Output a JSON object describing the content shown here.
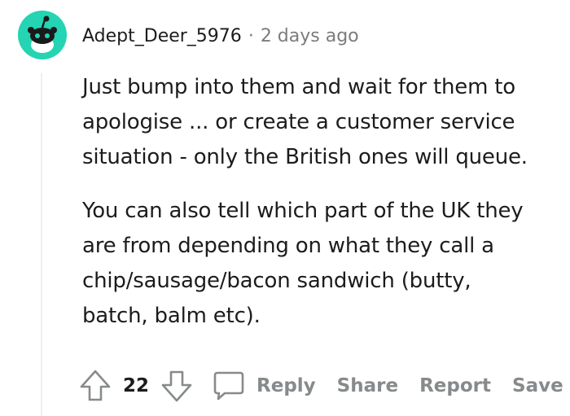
{
  "comment": {
    "username": "Adept_Deer_5976",
    "separator": "·",
    "timestamp": "2 days ago",
    "paragraphs": [
      "Just bump into them and wait for them to\napologise ... or create a customer service\nsituation - only the British ones will queue.",
      "You can also tell which part of the UK they\nare from depending on what they call a\nchip/sausage/bacon sandwich (butty,\nbatch, balm etc)."
    ]
  },
  "actions": {
    "upvote_icon": "arrow-up-icon",
    "vote_count": "22",
    "downvote_icon": "arrow-down-icon",
    "reply_icon": "speech-bubble-icon",
    "reply": "Reply",
    "share": "Share",
    "report": "Report",
    "save": "Save"
  },
  "colors": {
    "avatar_bg": "#24d4b3",
    "text": "#1c1c1c",
    "muted": "#7c7c7c",
    "action": "#878a8c"
  }
}
